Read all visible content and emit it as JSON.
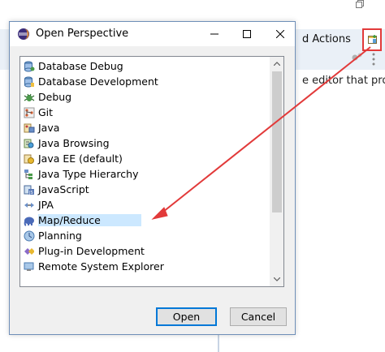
{
  "background": {
    "quick_actions_label": "d Actions",
    "description_fragment": "e editor that prov"
  },
  "dialog": {
    "title": "Open Perspective",
    "items": [
      {
        "label": "Database Debug",
        "icon": "database-debug-icon"
      },
      {
        "label": "Database Development",
        "icon": "database-development-icon"
      },
      {
        "label": "Debug",
        "icon": "debug-icon"
      },
      {
        "label": "Git",
        "icon": "git-icon"
      },
      {
        "label": "Java",
        "icon": "java-icon"
      },
      {
        "label": "Java Browsing",
        "icon": "java-browsing-icon"
      },
      {
        "label": "Java EE (default)",
        "icon": "java-ee-icon"
      },
      {
        "label": "Java Type Hierarchy",
        "icon": "java-type-hierarchy-icon"
      },
      {
        "label": "JavaScript",
        "icon": "javascript-icon"
      },
      {
        "label": "JPA",
        "icon": "jpa-icon"
      },
      {
        "label": "Map/Reduce",
        "icon": "map-reduce-elephant-icon",
        "selected": true
      },
      {
        "label": "Planning",
        "icon": "planning-icon"
      },
      {
        "label": "Plug-in Development",
        "icon": "plugin-development-icon"
      },
      {
        "label": "Remote System Explorer",
        "icon": "remote-system-explorer-icon"
      }
    ],
    "open_label": "Open",
    "cancel_label": "Cancel"
  },
  "colors": {
    "selection": "#cce8ff",
    "annotation_red": "#e23a3a",
    "default_button_border": "#0078d7"
  }
}
